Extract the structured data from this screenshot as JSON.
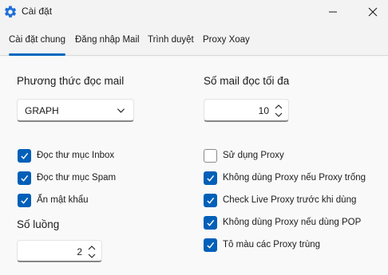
{
  "window": {
    "title": "Cài đặt",
    "icon": "gear-icon"
  },
  "tabs": [
    {
      "label": "Cài đặt chung",
      "active": true
    },
    {
      "label": "Đăng nhập Mail",
      "active": false
    },
    {
      "label": "Trình duyệt",
      "active": false
    },
    {
      "label": "Proxy Xoay",
      "active": false
    }
  ],
  "mail_read": {
    "label": "Phương thức đọc mail",
    "selected": "GRAPH"
  },
  "max_mail": {
    "label": "Số mail đọc tối đa",
    "value": "10"
  },
  "threads": {
    "label": "Số luồng",
    "value": "2"
  },
  "left_options": [
    {
      "label": "Đọc thư mục Inbox",
      "checked": true
    },
    {
      "label": "Đọc thư mục Spam",
      "checked": true
    },
    {
      "label": "Ẩn mật khẩu",
      "checked": true
    }
  ],
  "proxy_options": [
    {
      "label": "Sử dụng Proxy",
      "checked": false
    },
    {
      "label": "Không dùng Proxy nếu Proxy trống",
      "checked": true
    },
    {
      "label": "Check Live Proxy trước khi dùng",
      "checked": true
    },
    {
      "label": "Không dùng Proxy nếu dùng POP",
      "checked": true
    },
    {
      "label": "Tô màu các Proxy trùng",
      "checked": true
    }
  ],
  "colors": {
    "accent": "#005fb8",
    "tab_indicator": "#0067c0",
    "icon_blue": "#1e6fd9"
  }
}
